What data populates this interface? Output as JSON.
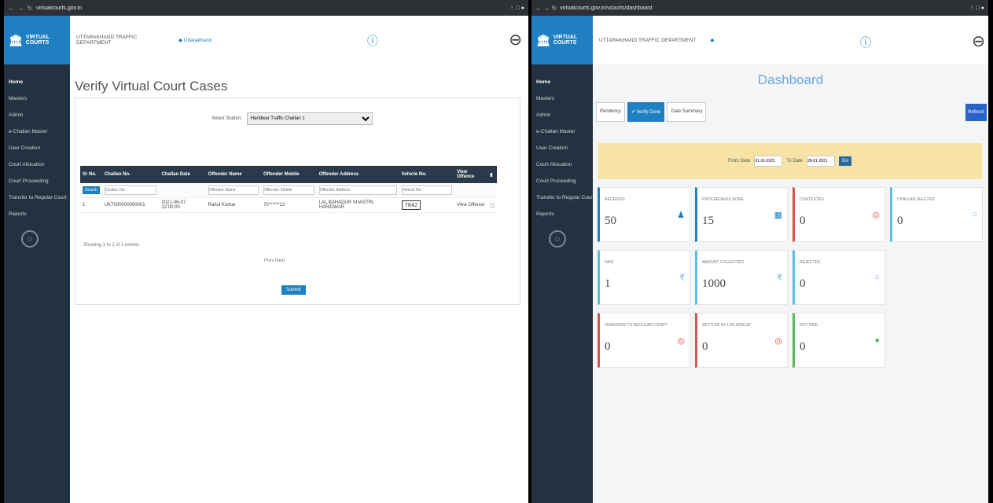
{
  "left": {
    "browser": {
      "nav": "← → ↻",
      "url": "virtualcourts.gov.in",
      "account": "⋮ □ ●"
    },
    "brand": "VIRTUAL COURTS",
    "menu": [
      "Home",
      "Masters",
      "Admin",
      "e-Challan Master",
      "User Creation",
      "Court Allocation",
      "Court Proceeding",
      "Transfer to Regular Court",
      "Reports"
    ],
    "topbar": {
      "department": "UTTARAKHAND TRAFFIC DEPARTMENT",
      "link": "◆ Uttarakhand"
    },
    "page_title": "Verify Virtual Court Cases",
    "filter": {
      "label": "Select Station:",
      "value": "Haridwar Traffic Challan 1"
    },
    "table": {
      "headers": [
        "Sr No.",
        "Challan No.",
        "Challan Date",
        "Offender Name",
        "Offender Mobile",
        "Offender Address",
        "Vehicle No.",
        "View Offence",
        "▮"
      ],
      "filter_row": {
        "search_label": "Search",
        "placeholders": [
          "Challan No.",
          "",
          "Offender Name",
          "Offender Mobile",
          "Offender Address",
          "Vehicle No.",
          "",
          ""
        ]
      },
      "rows": [
        {
          "sr": "1",
          "challan_no": "UK7000000000001",
          "date": "2021-06-07 12:00:00",
          "name": "Rahul Kumar",
          "mobile": "70******12",
          "address": "LAL BAHADUR SHASTRI, HARIDWAR",
          "vehicle": "7842",
          "offence": "View Offence",
          "check": "▢"
        }
      ]
    },
    "showing": "Showing 1 to 1 of 1 entries",
    "pager": "Prev  Next",
    "submit": "Submit"
  },
  "right": {
    "browser": {
      "nav": "← → ↻",
      "url": "virtualcourts.gov.in/vcourts/dashboard",
      "account": "⋮ □ ●"
    },
    "brand": "VIRTUAL COURTS",
    "menu": [
      "Home",
      "Masters",
      "Admin",
      "e-Challan Master",
      "User Creation",
      "Court Allocation",
      "Court Proceeding",
      "Transfer to Regular Court",
      "Reports"
    ],
    "topbar": {
      "department": "UTTARAKHAND TRAFFIC DEPARTMENT",
      "dot": "◆"
    },
    "dashboard_title": "Dashboard",
    "tabs": [
      "Pendency",
      "✔ Verify Done",
      "Date Summary"
    ],
    "refresh": "Refresh",
    "daterange": {
      "from_label": "From Date",
      "from_value": "01-01-2021",
      "to_label": "To Date",
      "to_value": "28-01-2021",
      "go": "Go"
    },
    "tiles": [
      {
        "label": "Received",
        "value": "50",
        "icon": "♟",
        "color": "#1f7fc1"
      },
      {
        "label": "Proceedings Done",
        "value": "15",
        "icon": "▦",
        "color": "#1f7fc1"
      },
      {
        "label": "Contested",
        "value": "0",
        "icon": "◎",
        "color": "#d9534f"
      },
      {
        "label": "Challan Deleted",
        "value": "0",
        "icon": "○",
        "color": "#5bc0de"
      },
      {
        "label": "Paid",
        "value": "1",
        "icon": "₹",
        "color": "#5bc0de"
      },
      {
        "label": "Amount Collected",
        "value": "1000",
        "icon": "₹",
        "color": "#5bc0de"
      },
      {
        "label": "Rejected",
        "value": "0",
        "icon": "○",
        "color": "#5bc0de"
      },
      {
        "label": "Transfer to Regular Court",
        "value": "0",
        "icon": "◎",
        "color": "#d9534f"
      },
      {
        "label": "Settled by Lok Adalat",
        "value": "0",
        "icon": "◎",
        "color": "#d9534f"
      },
      {
        "label": "Not Paid",
        "value": "0",
        "icon": "●",
        "color": "#5cb85c"
      }
    ]
  }
}
